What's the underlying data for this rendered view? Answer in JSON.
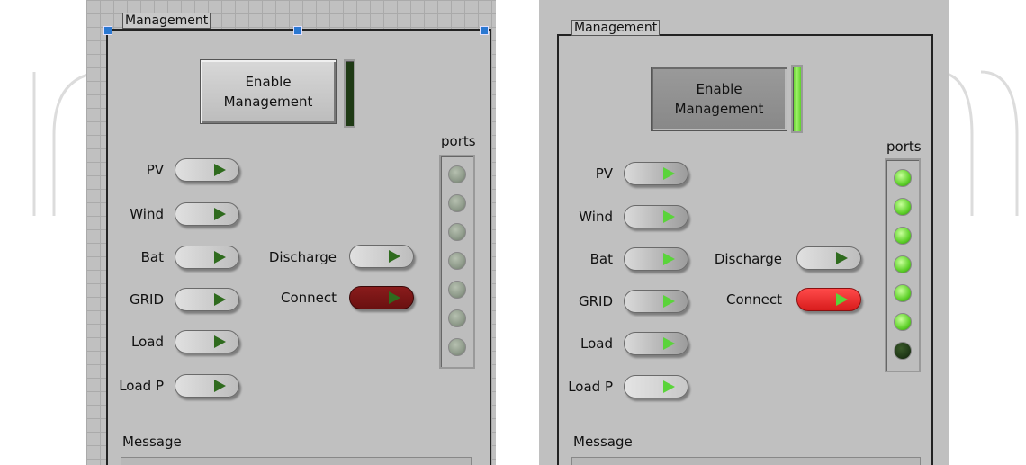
{
  "watermark": {
    "color": "#dcdcdc"
  },
  "left_panel": {
    "frame_title": "Management",
    "enable_button": {
      "line1": "Enable",
      "line2": "Management",
      "state": "off"
    },
    "indicator_state": "off",
    "ports_label": "ports",
    "inputs": [
      {
        "label": "PV"
      },
      {
        "label": "Wind"
      },
      {
        "label": "Bat"
      },
      {
        "label": "GRID"
      },
      {
        "label": "Load"
      },
      {
        "label": "Load P"
      }
    ],
    "discharge_label": "Discharge",
    "connect_label": "Connect",
    "connect_color": "#7a1616",
    "ports": [
      "off",
      "off",
      "off",
      "off",
      "off",
      "off",
      "off"
    ],
    "message_label": "Message"
  },
  "right_panel": {
    "frame_title": "Management",
    "enable_button": {
      "line1": "Enable",
      "line2": "Management",
      "state": "on"
    },
    "indicator_state": "on",
    "ports_label": "ports",
    "inputs": [
      {
        "label": "PV"
      },
      {
        "label": "Wind"
      },
      {
        "label": "Bat"
      },
      {
        "label": "GRID"
      },
      {
        "label": "Load"
      },
      {
        "label": "Load P"
      }
    ],
    "discharge_label": "Discharge",
    "connect_label": "Connect",
    "connect_color": "#e62a2a",
    "ports": [
      "on",
      "on",
      "on",
      "on",
      "on",
      "on",
      "dark"
    ],
    "message_label": "Message"
  },
  "colors": {
    "led_off": "#8e9a8a",
    "led_on": "#5fd12a",
    "led_dark": "#213a18",
    "bar_off": "#1f3a15",
    "bar_on": "#7ee04a",
    "toggle_left": "#d4d4d4",
    "toggle_right_active": "#9c9c9c",
    "tri_off": "#2f6b1e",
    "tri_on": "#5ad43a"
  }
}
